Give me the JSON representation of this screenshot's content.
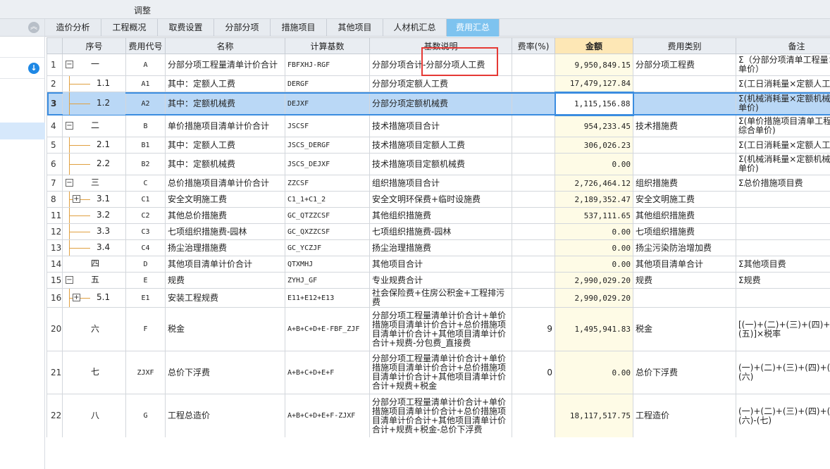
{
  "window": {
    "top_label": "调整"
  },
  "left_panel": {
    "collapse_icon": "collapse-up-icon",
    "download_icon": "download-icon"
  },
  "tabs": [
    {
      "label": "造价分析",
      "active": false
    },
    {
      "label": "工程概况",
      "active": false
    },
    {
      "label": "取费设置",
      "active": false
    },
    {
      "label": "分部分项",
      "active": false
    },
    {
      "label": "措施项目",
      "active": false
    },
    {
      "label": "其他项目",
      "active": false
    },
    {
      "label": "人材机汇总",
      "active": false
    },
    {
      "label": "费用汇总",
      "active": true
    }
  ],
  "columns": [
    "序号",
    "费用代号",
    "名称",
    "计算基数",
    "基数说明",
    "费率(%)",
    "金额",
    "费用类别",
    "备注"
  ],
  "rows": [
    {
      "rn": "1",
      "seq": "一",
      "level": 0,
      "expander": "−",
      "code": "A",
      "name": "分部分项工程量清单计价合计",
      "base": "FBFXHJ-RGF",
      "desc": "分部分项合计-分部分项人工费",
      "rate": "",
      "amount": "9,950,849.15",
      "category": "分部分项工程费",
      "note": "Σ（分部分项清单工程量×综合单价）"
    },
    {
      "rn": "2",
      "seq": "1.1",
      "level": 1,
      "expander": "",
      "code": "A1",
      "name": "其中：定额人工费",
      "base": "DERGF",
      "desc": "分部分项定额人工费",
      "rate": "",
      "amount": "17,479,127.84",
      "category": "",
      "note": "Σ(工日消耗量×定额人工单价)"
    },
    {
      "rn": "3",
      "seq": "1.2",
      "level": 1,
      "expander": "",
      "code": "A2",
      "name": "其中：定额机械费",
      "base": "DEJXF",
      "desc": "分部分项定额机械费",
      "rate": "",
      "amount": "1,115,156.88",
      "category": "",
      "note": "Σ(机械消耗量×定额机械台班单价)"
    },
    {
      "rn": "4",
      "seq": "二",
      "level": 0,
      "expander": "−",
      "code": "B",
      "name": "单价措施项目清单计价合计",
      "base": "JSCSF",
      "desc": "技术措施项目合计",
      "rate": "",
      "amount": "954,233.45",
      "category": "技术措施费",
      "note": "Σ(单价措施项目清单工程量×综合单价)"
    },
    {
      "rn": "5",
      "seq": "2.1",
      "level": 1,
      "expander": "",
      "code": "B1",
      "name": "其中：定额人工费",
      "base": "JSCS_DERGF",
      "desc": "技术措施项目定额人工费",
      "rate": "",
      "amount": "306,026.23",
      "category": "",
      "note": "Σ(工日消耗量×定额人工单价)"
    },
    {
      "rn": "6",
      "seq": "2.2",
      "level": 1,
      "expander": "",
      "code": "B2",
      "name": "其中：定额机械费",
      "base": "JSCS_DEJXF",
      "desc": "技术措施项目定额机械费",
      "rate": "",
      "amount": "0.00",
      "category": "",
      "note": "Σ(机械消耗量×定额机械台班单价)"
    },
    {
      "rn": "7",
      "seq": "三",
      "level": 0,
      "expander": "−",
      "code": "C",
      "name": "总价措施项目清单计价合计",
      "base": "ZZCSF",
      "desc": "组织措施项目合计",
      "rate": "",
      "amount": "2,726,464.12",
      "category": "组织措施费",
      "note": "Σ总价措施项目费"
    },
    {
      "rn": "8",
      "seq": "3.1",
      "level": 1,
      "expander": "+",
      "code": "C1",
      "name": "安全文明施工费",
      "base": "C1_1+C1_2",
      "desc": "安全文明环保费+临时设施费",
      "rate": "",
      "amount": "2,189,352.47",
      "category": "安全文明施工费",
      "note": ""
    },
    {
      "rn": "11",
      "seq": "3.2",
      "level": 1,
      "expander": "",
      "code": "C2",
      "name": "其他总价措施费",
      "base": "GC_QTZZCSF",
      "desc": "其他组织措施费",
      "rate": "",
      "amount": "537,111.65",
      "category": "其他组织措施费",
      "note": ""
    },
    {
      "rn": "12",
      "seq": "3.3",
      "level": 1,
      "expander": "",
      "code": "C3",
      "name": "七项组织措施费-园林",
      "base": "GC_QXZZCSF",
      "desc": "七项组织措施费-园林",
      "rate": "",
      "amount": "0.00",
      "category": "七项组织措施费",
      "note": ""
    },
    {
      "rn": "13",
      "seq": "3.4",
      "level": 1,
      "expander": "",
      "code": "C4",
      "name": "扬尘治理措施费",
      "base": "GC_YCZJF",
      "desc": "扬尘治理措施费",
      "rate": "",
      "amount": "0.00",
      "category": "扬尘污染防治增加费",
      "note": ""
    },
    {
      "rn": "14",
      "seq": "四",
      "level": 0,
      "expander": "",
      "code": "D",
      "name": "其他项目清单计价合计",
      "base": "QTXMHJ",
      "desc": "其他项目合计",
      "rate": "",
      "amount": "0.00",
      "category": "其他项目清单合计",
      "note": "Σ其他项目费"
    },
    {
      "rn": "15",
      "seq": "五",
      "level": 0,
      "expander": "−",
      "code": "E",
      "name": "规费",
      "base": "ZYHJ_GF",
      "desc": "专业规费合计",
      "rate": "",
      "amount": "2,990,029.20",
      "category": "规费",
      "note": "Σ规费"
    },
    {
      "rn": "16",
      "seq": "5.1",
      "level": 1,
      "expander": "+",
      "code": "E1",
      "name": "安装工程规费",
      "base": "E11+E12+E13",
      "desc": "社会保险费+住房公积金+工程排污费",
      "rate": "",
      "amount": "2,990,029.20",
      "category": "",
      "note": ""
    },
    {
      "rn": "20",
      "seq": "六",
      "level": 0,
      "expander": "",
      "code": "F",
      "name": "税金",
      "base": "A+B+C+D+E-FBF_ZJF",
      "desc": "分部分项工程量清单计价合计+单价措施项目清单计价合计+总价措施项目清单计价合计+其他项目清单计价合计+规费-分包费_直接费",
      "rate": "9",
      "amount": "1,495,941.83",
      "category": "税金",
      "note": "[(一)+(二)+(三)+(四)+(五)]×税率"
    },
    {
      "rn": "21",
      "seq": "七",
      "level": 0,
      "expander": "",
      "code": "ZJXF",
      "name": "总价下浮费",
      "base": "A+B+C+D+E+F",
      "desc": "分部分项工程量清单计价合计+单价措施项目清单计价合计+总价措施项目清单计价合计+其他项目清单计价合计+规费+税金",
      "rate": "0",
      "amount": "0.00",
      "category": "总价下浮费",
      "note": "(一)+(二)+(三)+(四)+(五)+(六)"
    },
    {
      "rn": "22",
      "seq": "八",
      "level": 0,
      "expander": "",
      "code": "G",
      "name": "工程总造价",
      "base": "A+B+C+D+E+F-ZJXF",
      "desc": "分部分项工程量清单计价合计+单价措施项目清单计价合计+总价措施项目清单计价合计+其他项目清单计价合计+规费+税金-总价下浮费",
      "rate": "",
      "amount": "18,117,517.75",
      "category": "工程造价",
      "note": "(一)+(二)+(三)+(四)+(五)+(六)-(七)"
    }
  ],
  "selected_row": "3",
  "colors": {
    "accent_tab": "#7ec3ef",
    "selection": "#bad8f6",
    "amount_header": "#fde7b5",
    "highlight_box": "#e53935"
  }
}
